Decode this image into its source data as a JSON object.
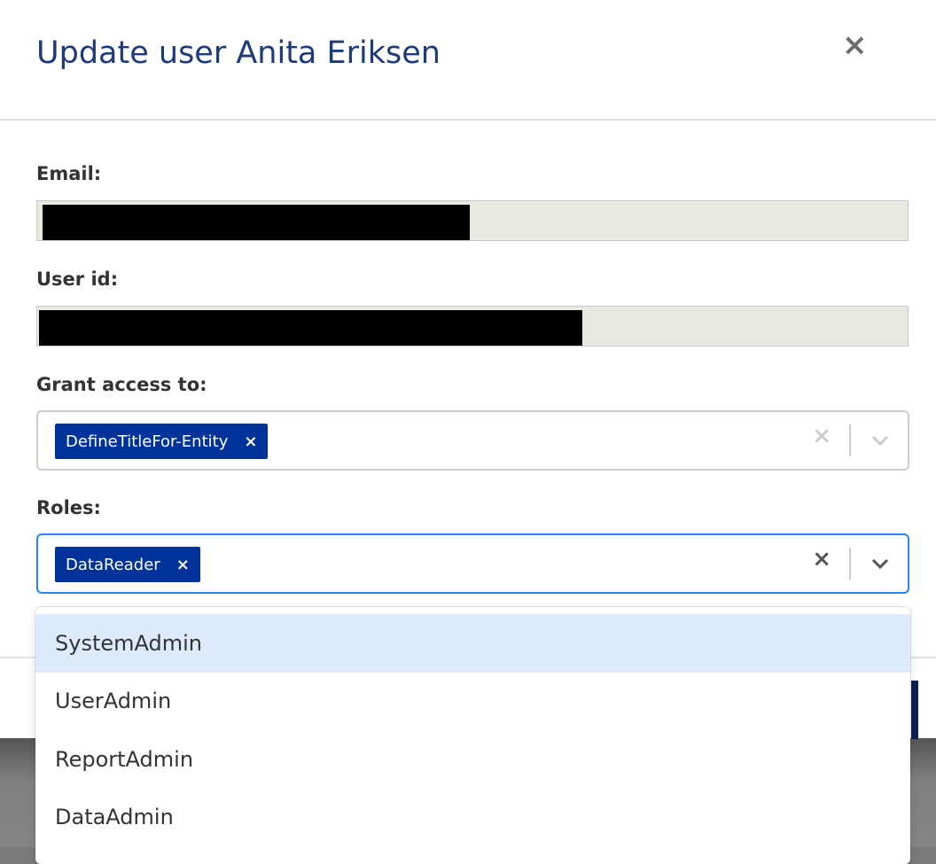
{
  "dialog": {
    "title": "Update user Anita Eriksen",
    "close_icon": "×"
  },
  "fields": {
    "email_label": "Email:",
    "user_id_label": "User id:",
    "grant_label": "Grant access to:",
    "grant_selected": [
      "DefineTitleFor-Entity"
    ],
    "roles_label": "Roles:",
    "roles_selected": [
      "DataReader"
    ],
    "remove_glyph": "×",
    "clear_glyph": "×"
  },
  "roles_menu": {
    "options": [
      "SystemAdmin",
      "UserAdmin",
      "ReportAdmin",
      "DataAdmin"
    ],
    "highlighted": "SystemAdmin"
  },
  "colors": {
    "title": "#1d3a7a",
    "chip": "#003399",
    "focus": "#2684ff",
    "highlight": "#deebff"
  }
}
